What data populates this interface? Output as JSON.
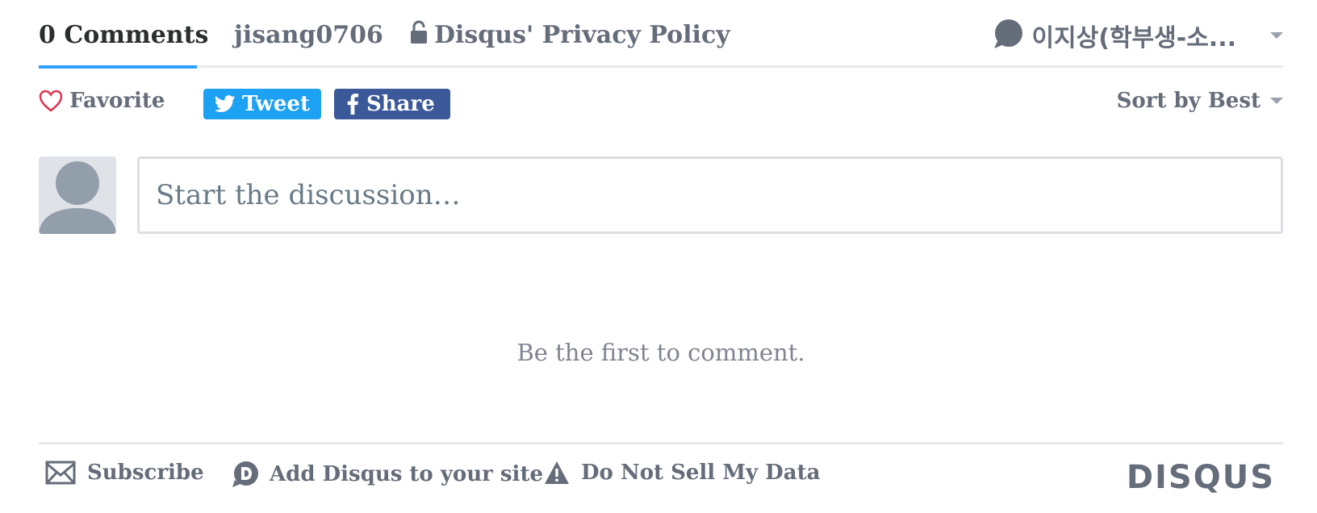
{
  "nav": {
    "comments_tab": "0 Comments",
    "user_tab": "jisang0706",
    "privacy_tab": "Disqus' Privacy Policy",
    "account_name": "이지상(학부생-소..."
  },
  "actions": {
    "favorite_label": "Favorite",
    "tweet_label": "Tweet",
    "share_label": "Share",
    "sort_label": "Sort by Best"
  },
  "compose": {
    "placeholder": "Start the discussion…"
  },
  "empty_message": "Be the first to comment.",
  "footer": {
    "subscribe": "Subscribe",
    "add_disqus": "Add Disqus to your site",
    "do_not_sell": "Do Not Sell My Data",
    "logo": "DISQUS"
  },
  "colors": {
    "accent": "#2e9fff",
    "twitter": "#1da1f2",
    "facebook": "#3b5998",
    "text": "#656c7a",
    "heart": "#e0334f"
  },
  "icons": [
    "lock-icon",
    "chat-bubble-icon",
    "heart-icon",
    "twitter-bird-icon",
    "facebook-f-icon",
    "chevron-down-icon",
    "avatar-icon",
    "envelope-icon",
    "disqus-d-icon",
    "warning-icon"
  ]
}
